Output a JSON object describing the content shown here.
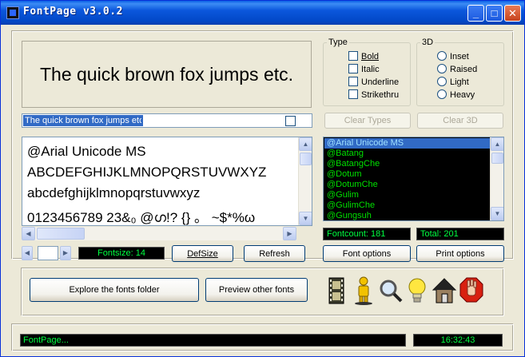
{
  "window": {
    "title": "FontPage v3.0.2"
  },
  "preview": {
    "text": "The quick brown fox jumps etc."
  },
  "type_group": {
    "legend": "Type",
    "options": [
      "Bold",
      "Italic",
      "Underline",
      "Strikethru"
    ]
  },
  "three_d_group": {
    "legend": "3D",
    "options": [
      "Inset",
      "Raised",
      "Light",
      "Heavy"
    ]
  },
  "buttons": {
    "clear_types": "Clear Types",
    "clear_3d": "Clear 3D",
    "defsize": "DefSize",
    "refresh": "Refresh",
    "font_options": "Font options",
    "print_options": "Print options",
    "explore": "Explore the fonts folder",
    "preview_other": "Preview other fonts"
  },
  "sample_input": {
    "value": "The quick brown fox jumps etc."
  },
  "sample": {
    "lines": [
      "@Arial Unicode MS",
      "ABCDEFGHIJKLMNOPQRSTUVWXYZ",
      "abcdefghijklmnopqrstuvwxyz",
      "0123456789 23&₀ @ഗ!? {} 。 ~$*%ω"
    ]
  },
  "font_list": {
    "items": [
      "@Arial Unicode MS",
      "@Batang",
      "@BatangChe",
      "@Dotum",
      "@DotumChe",
      "@Gulim",
      "@GulimChe",
      "@Gungsuh"
    ],
    "selected_index": 0
  },
  "counters": {
    "fontcount": "Fontcount: 181",
    "total": "Total: 201",
    "fontsize": "Fontsize: 14"
  },
  "tool_icons": [
    "film-icon",
    "person-icon",
    "magnifier-icon",
    "lightbulb-icon",
    "house-icon",
    "stop-hand-icon"
  ],
  "status": {
    "text": "FontPage...",
    "time": "16:32:43"
  },
  "colors": {
    "lcd_text": "#00ff40",
    "list_text": "#00e000",
    "selection": "#316ac5",
    "titlebar": "#0B57DC"
  }
}
